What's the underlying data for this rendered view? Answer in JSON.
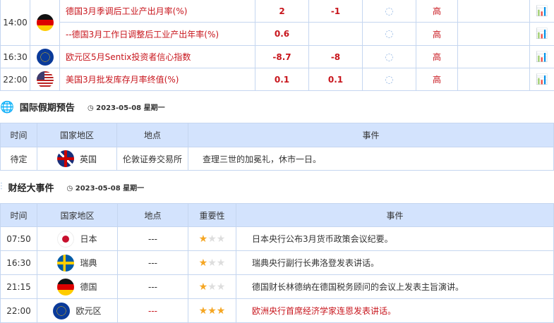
{
  "indicators": [
    {
      "time": "14:00",
      "flag": "de",
      "name": "德国3月季调后工业产出月率(%)",
      "actual": "2",
      "forecast": "-1",
      "importance": "高"
    },
    {
      "time": "",
      "flag": "",
      "name": "--德国3月工作日调整后工业产出年率(%)",
      "actual": "0.6",
      "forecast": "",
      "importance": "高"
    },
    {
      "time": "16:30",
      "flag": "eu",
      "name": "欧元区5月Sentix投资者信心指数",
      "actual": "-8.7",
      "forecast": "-8",
      "importance": "高"
    },
    {
      "time": "22:00",
      "flag": "us",
      "name": "美国3月批发库存月率终值(%)",
      "actual": "0.1",
      "forecast": "0.1",
      "importance": "高"
    }
  ],
  "holiday": {
    "title": "国际假期预告",
    "date": "2023-05-08 星期一",
    "headers": [
      "时间",
      "国家地区",
      "地点",
      "事件"
    ],
    "rows": [
      {
        "time": "待定",
        "flag": "uk",
        "country": "英国",
        "place": "伦敦证券交易所",
        "event": "查理三世的加冕礼，休市一日。"
      }
    ]
  },
  "events": {
    "title": "财经大事件",
    "date": "2023-05-08 星期一",
    "headers": [
      "时间",
      "国家地区",
      "地点",
      "重要性",
      "事件"
    ],
    "rows": [
      {
        "time": "07:50",
        "flag": "jp",
        "country": "日本",
        "place": "---",
        "stars": 1,
        "event": "日本央行公布3月货币政策会议纪要。"
      },
      {
        "time": "16:30",
        "flag": "se",
        "country": "瑞典",
        "place": "---",
        "stars": 1,
        "event": "瑞典央行副行长弗洛登发表讲话。"
      },
      {
        "time": "21:15",
        "flag": "de",
        "country": "德国",
        "place": "---",
        "stars": 1,
        "event": "德国财长林德纳在德国税务顾问的会议上发表主旨演讲。"
      },
      {
        "time": "22:00",
        "flag": "eu",
        "country": "欧元区",
        "place": "---",
        "stars": 3,
        "event": "欧洲央行首席经济学家连恩发表讲话。",
        "highlight": true
      }
    ]
  }
}
